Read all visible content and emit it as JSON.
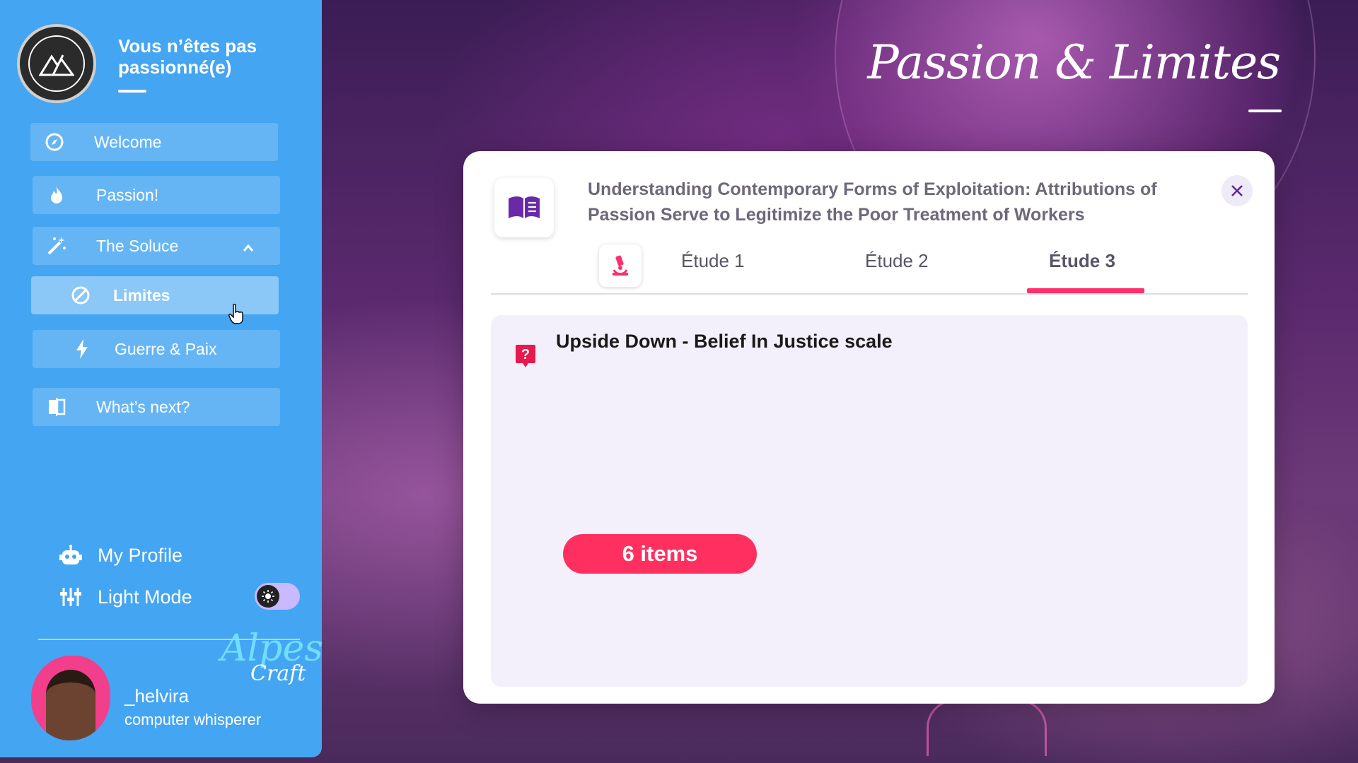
{
  "sidebar": {
    "brand_title": "Vous n’êtes pas passionné(e)",
    "items": [
      {
        "label": "Welcome",
        "icon": "compass-icon"
      },
      {
        "label": "Passion!",
        "icon": "flame-icon"
      },
      {
        "label": "The Soluce",
        "icon": "magic-wand-icon"
      },
      {
        "label": "Limites",
        "icon": "ban-icon"
      },
      {
        "label": "Guerre & Paix",
        "icon": "bolt-icon"
      },
      {
        "label": "What’s next?",
        "icon": "compare-icon"
      }
    ],
    "profile_label": "My Profile",
    "light_mode_label": "Light Mode",
    "user_name": "_helvira",
    "user_role": "computer whisperer"
  },
  "header": {
    "page_title": "Passion & Limites"
  },
  "modal": {
    "title": "Understanding Contemporary Forms of Exploitation: Attributions of Passion Serve to Legitimize the Poor Treatment of Workers",
    "tabs": [
      "Étude 1",
      "Étude 2",
      "Étude 3"
    ],
    "active_tab": "Étude 3",
    "panel_title": "Upside Down - Belief In Justice scale",
    "items_count_label": "6 items"
  },
  "colors": {
    "sidebar": "#44a5f2",
    "accent": "#ff2f6d",
    "book_icon": "#6a2aa8",
    "panel_bg": "#f3f0fb"
  }
}
